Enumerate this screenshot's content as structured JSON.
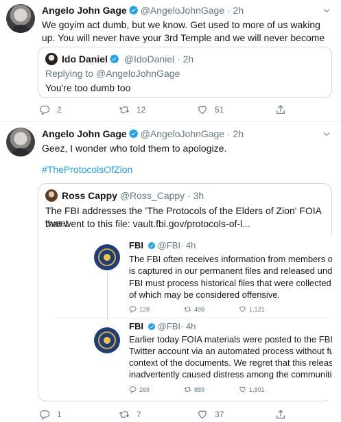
{
  "tweet1": {
    "name": "Angelo John Gage",
    "handle": "@AngeloJohnGage",
    "time": "· 2h",
    "text": "We goyim act dumb, but we know. Get used to more of us waking up. You will never have your 3rd Temple and we will never become Noahide slaves.",
    "quote": {
      "name": "Ido Daniel",
      "handle": "@IdoDaniel",
      "time": "· 2h",
      "replying": "Replying to @AngeloJohnGage",
      "text": "You're too dumb too"
    },
    "actions": {
      "replies": "2",
      "retweets": "12",
      "likes": "51"
    }
  },
  "tweet2": {
    "name": "Angelo John Gage",
    "handle": "@AngeloJohnGage",
    "time": "· 2h",
    "text": "Geez, I wonder who told them to apologize.",
    "hashtag": "#TheProtocolsOfZion",
    "quote": {
      "name": "Ross Cappy",
      "handle": "@Ross_Cappy",
      "time": "· 3h",
      "text_line1": "The FBI addresses the 'The Protocols of the Elders of Zion' FOIA tweet",
      "text_line2": "that went to this file: vault.fbi.gov/protocols-of-l..."
    },
    "embedded": {
      "fbi1": {
        "name": "FBI",
        "handle": "@FBI",
        "time": "· 4h",
        "lines": [
          "The FBI often receives information from members of th",
          "is captured in our permanent files and released under F",
          "FBI must process historical files that were collected in t",
          "of which may be considered offensive."
        ],
        "actions": {
          "replies": "128",
          "retweets": "498",
          "likes": "1,121"
        }
      },
      "fbi2": {
        "name": "FBI",
        "handle": "@FBI",
        "time": "· 4h",
        "lines": [
          "Earlier today FOIA materials were posted to the FBI's Va",
          "Twitter account via an automated process without furth",
          "context of the documents. We regret that this release m",
          "inadvertently caused distress among the communities"
        ],
        "actions": {
          "replies": "269",
          "retweets": "889",
          "likes": "1,801"
        }
      }
    },
    "actions": {
      "replies": "1",
      "retweets": "7",
      "likes": "37"
    }
  },
  "colors": {
    "link": "#1da1f2",
    "meta": "#657786",
    "border": "#ccd6dd"
  }
}
